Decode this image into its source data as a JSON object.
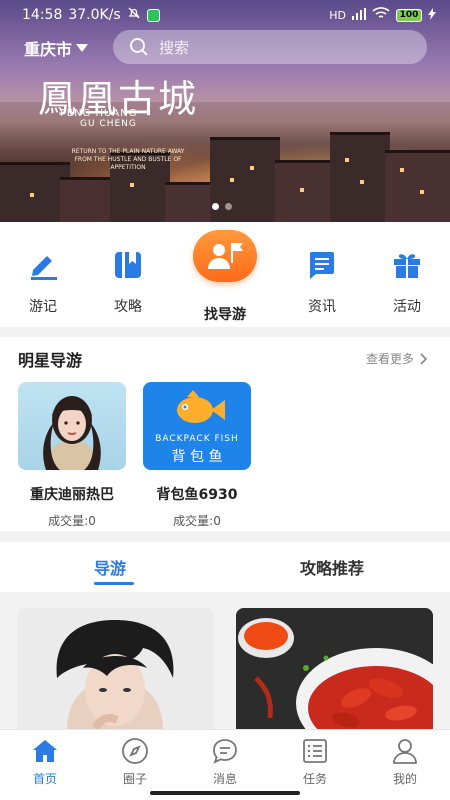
{
  "status_bar": {
    "time": "14:58",
    "speed": "37.0K/s",
    "network": "HD",
    "battery": "100"
  },
  "header": {
    "city": "重庆市",
    "search_placeholder": "搜索"
  },
  "banner": {
    "title": "鳳凰古城",
    "subtitle_line1": "FENG HUANG",
    "subtitle_line2": "GU CHENG",
    "tagline": "RETURN TO THE PLAIN NATURE AWAY FROM THE HUSTLE AND BUSTLE OF APPETITION",
    "dots": 2,
    "active_dot": 1
  },
  "quick_menu": [
    {
      "label": "游记",
      "icon": "pencil-icon"
    },
    {
      "label": "攻略",
      "icon": "book-icon"
    },
    {
      "label": "找导游",
      "icon": "guide-flag-icon",
      "active": true
    },
    {
      "label": "资讯",
      "icon": "news-icon"
    },
    {
      "label": "活动",
      "icon": "gift-icon"
    }
  ],
  "star_guides": {
    "title": "明星导游",
    "more": "查看更多",
    "items": [
      {
        "name": "重庆迪丽热巴",
        "deals": "成交量:0"
      },
      {
        "name": "背包鱼6930",
        "deals": "成交量:0",
        "logo_line1": "BACKPACK  FISH",
        "logo_line2": "背 包 鱼"
      }
    ]
  },
  "tabs": [
    {
      "label": "导游",
      "active": true
    },
    {
      "label": "攻略推荐",
      "active": false
    }
  ],
  "bottom_nav": [
    {
      "label": "首页",
      "icon": "home-icon",
      "active": true
    },
    {
      "label": "圈子",
      "icon": "compass-icon"
    },
    {
      "label": "消息",
      "icon": "message-icon"
    },
    {
      "label": "任务",
      "icon": "task-list-icon"
    },
    {
      "label": "我的",
      "icon": "person-icon"
    }
  ],
  "colors": {
    "accent": "#2a7be4",
    "orange": "#ff7a22"
  }
}
